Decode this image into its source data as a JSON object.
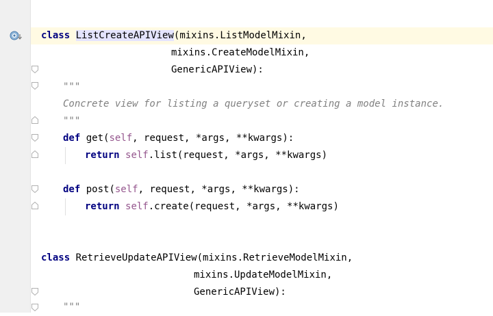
{
  "code": {
    "class1": {
      "keyword": "class",
      "name": "ListCreateAPIView",
      "base1": "(mixins.ListModelMixin,",
      "base2": "mixins.CreateModelMixin,",
      "base3": "GenericAPIView):",
      "doc_open": "\"\"\"",
      "doc_text": "Concrete view for listing a queryset or creating a model instance.",
      "doc_close": "\"\"\"",
      "m1_def": "def",
      "m1_name": " get(",
      "m1_self": "self",
      "m1_args": ", request, *args, **kwargs):",
      "m1_return": "return",
      "m1_self2": "self",
      "m1_body": ".list(request, *args, **kwargs)",
      "m2_def": "def",
      "m2_name": " post(",
      "m2_self": "self",
      "m2_args": ", request, *args, **kwargs):",
      "m2_return": "return",
      "m2_self2": "self",
      "m2_body": ".create(request, *args, **kwargs)"
    },
    "class2": {
      "keyword": "class",
      "name": " RetrieveUpdateAPIView(mixins.RetrieveModelMixin,",
      "base2": "mixins.UpdateModelMixin,",
      "base3": "GenericAPIView):",
      "doc_open": "\"\"\""
    }
  },
  "gutter": {
    "override_icon": "override-method-icon",
    "fold_icon": "fold-marker-icon"
  },
  "colors": {
    "keyword": "#000080",
    "self": "#94558d",
    "docstring": "#808080",
    "caret_line": "#fffae3",
    "identifier_highlight": "#e4e4ff"
  }
}
